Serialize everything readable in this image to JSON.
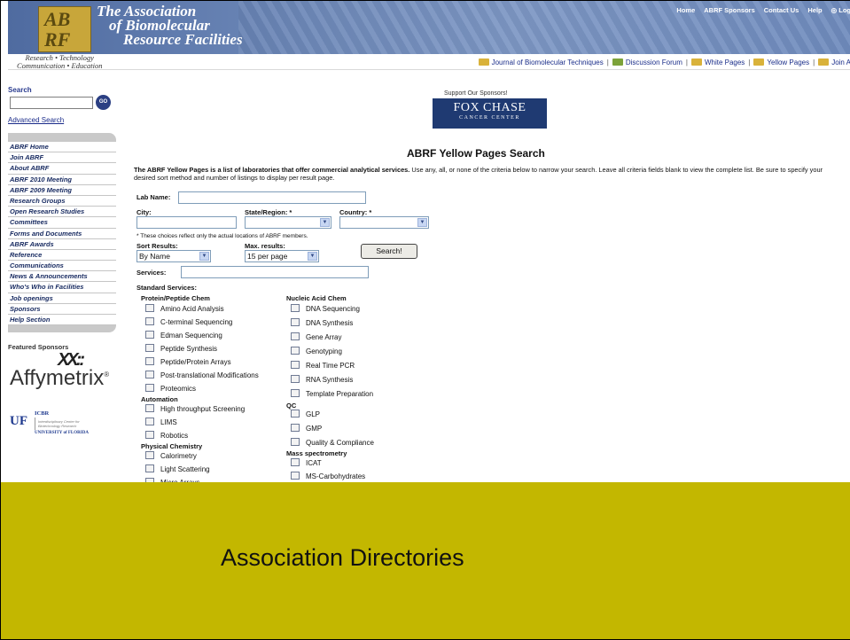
{
  "banner": {
    "logo_letters": [
      "AB",
      "RF"
    ],
    "org_name_lines": [
      "The Association",
      "of Biomolecular",
      "Resource Facilities"
    ],
    "top_links": [
      "Home",
      "ABRF Sponsors",
      "Contact Us",
      "Help",
      "◎ Log"
    ]
  },
  "subbar": {
    "tagline_lines": [
      "Research • Technology",
      "Communication • Education"
    ],
    "quick_links": [
      "Journal of Biomolecular Techniques",
      "Discussion Forum",
      "White Pages",
      "Yellow Pages",
      "Join A"
    ]
  },
  "sidebar": {
    "search_label": "Search",
    "go_label": "GO",
    "advanced_search": "Advanced Search",
    "nav_items": [
      "ABRF Home",
      "Join ABRF",
      "About ABRF",
      "ABRF 2010 Meeting",
      "ABRF 2009 Meeting",
      "Research Groups",
      "Open Research Studies",
      "Committees",
      "Forms and Documents",
      "ABRF Awards",
      "Reference",
      "Communications",
      "News & Announcements",
      "Who's Who in Facilities",
      "Job openings",
      "Sponsors",
      "Help Section"
    ],
    "featured_label": "Featured Sponsors",
    "affymetrix": {
      "mark": "XX::",
      "name": "Affymetrix",
      "reg": "®"
    },
    "uf": {
      "mark": "UF",
      "icbr": "ICBR",
      "line1": "Interdisciplinary Center for",
      "line2": "Biotechnology Research",
      "univ": "UNIVERSITY of FLORIDA"
    }
  },
  "main": {
    "sponsor_label": "Support Our Sponsors!",
    "foxchase_big": "FOX CHASE",
    "foxchase_small": "CANCER CENTER",
    "title": "ABRF Yellow Pages Search",
    "intro_bold": "The ABRF Yellow Pages is a list of laboratories that offer commercial analytical services.",
    "intro_rest": " Use any, all, or none of the criteria below to narrow your search. Leave all criteria fields blank to view the complete list. Be sure to specify your desired sort method and number of listings to display per result page.",
    "lab_name_label": "Lab Name:",
    "city_label": "City:",
    "state_label": "State/Region: *",
    "country_label": "Country: *",
    "note": "* These choices reflect only the actual locations of ABRF members.",
    "sort_label": "Sort Results:",
    "sort_value": "By Name",
    "max_label": "Max. results:",
    "max_value": "15 per page",
    "search_button": "Search!",
    "services_label": "Services:",
    "standard_services": "Standard Services:",
    "col1": [
      {
        "heading": "Protein/Peptide Chem",
        "items": [
          "Amino Acid Analysis",
          "C-terminal Sequencing",
          "Edman Sequencing",
          "Peptide Synthesis",
          "Peptide/Protein Arrays",
          "Post-translational Modifications",
          "Proteomics"
        ]
      },
      {
        "heading": "Automation",
        "items": [
          "High throughput Screening",
          "LIMS",
          "Robotics"
        ]
      },
      {
        "heading": "Physical Chemistry",
        "items": [
          "Calorimetry",
          "Light Scattering",
          "Micro Arrays"
        ]
      }
    ],
    "col2": [
      {
        "heading": "Nucleic Acid Chem",
        "items": [
          "DNA Sequencing",
          "DNA Synthesis",
          "Gene Array",
          "Genotyping",
          "Real Time PCR",
          "RNA Synthesis",
          "Template Preparation"
        ]
      },
      {
        "heading": "QC",
        "items": [
          "GLP",
          "GMP",
          "Quality & Compliance"
        ]
      },
      {
        "heading": "Mass spectrometry",
        "items": [
          "ICAT",
          "MS-Carbohydrates"
        ]
      }
    ]
  },
  "caption": "Association Directories",
  "colors": {
    "band": "#c3b700",
    "banner": "#6d88b8",
    "nav_text": "#15285f"
  }
}
